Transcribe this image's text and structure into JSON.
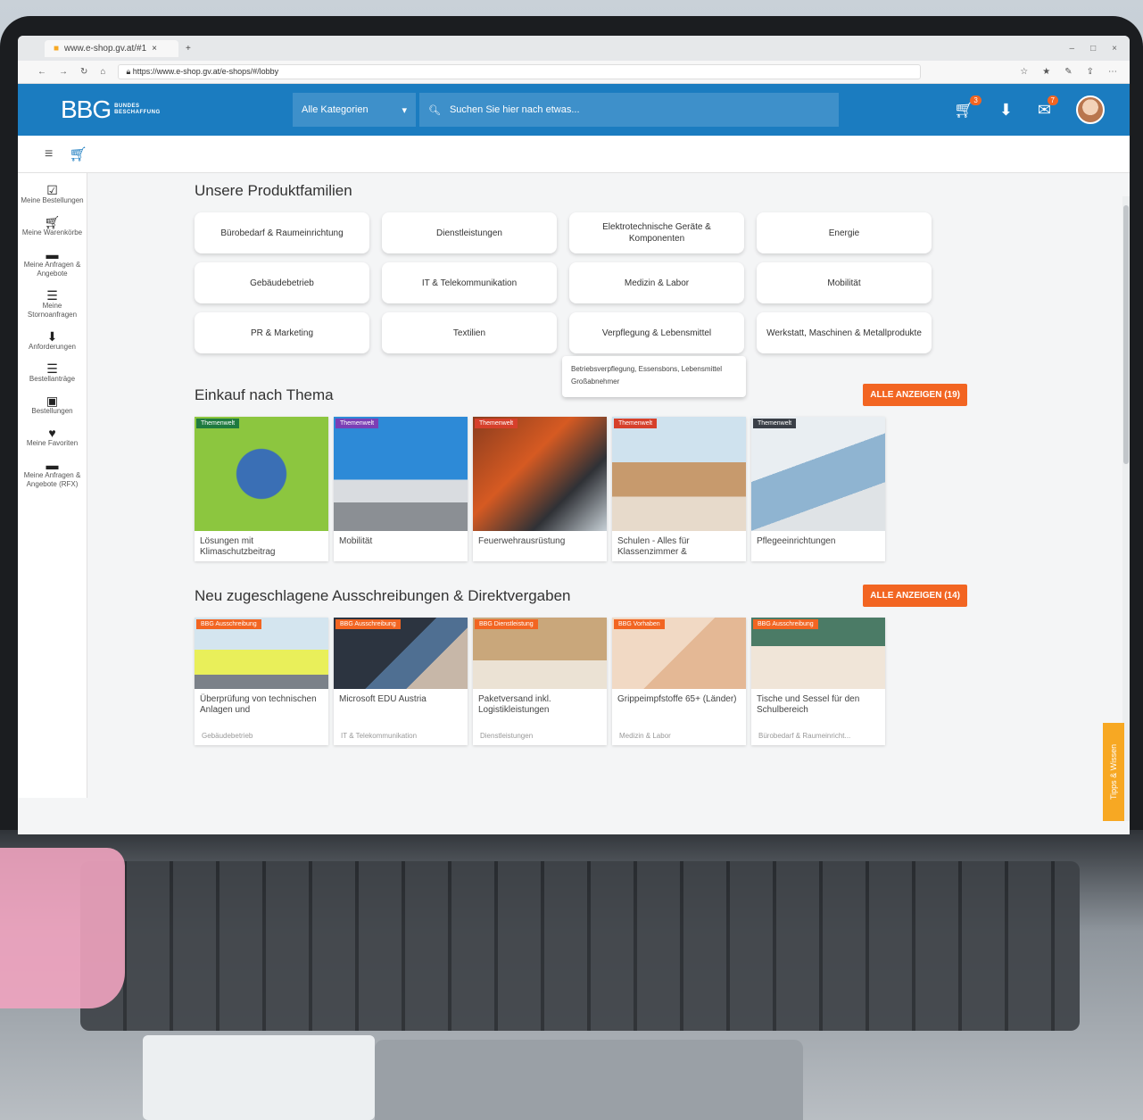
{
  "browser": {
    "tab_title": "www.e-shop.gv.at/#1",
    "url": "https://www.e-shop.gv.at/e-shops/#/lobby"
  },
  "header": {
    "logo_main": "BBG",
    "logo_sub": "BUNDES BESCHAFFUNG",
    "category_select": "Alle Kategorien",
    "search_placeholder": "Suchen Sie hier nach etwas...",
    "cart_badge": "3",
    "mail_badge": "7"
  },
  "sidebar": {
    "items": [
      {
        "label": "Meine Bestellungen",
        "icon": "clipboard-check-icon"
      },
      {
        "label": "Meine Warenkörbe",
        "icon": "cart-icon"
      },
      {
        "label": "Meine Anfragen & Angebote",
        "icon": "chat-icon"
      },
      {
        "label": "Meine Stornoanfragen",
        "icon": "cancel-list-icon"
      },
      {
        "label": "Anforderungen",
        "icon": "inbox-download-icon"
      },
      {
        "label": "Bestellanträge",
        "icon": "list-icon"
      },
      {
        "label": "Bestellungen",
        "icon": "clipboard-icon"
      },
      {
        "label": "Meine Favoriten",
        "icon": "heart-icon"
      },
      {
        "label": "Meine Anfragen & Angebote (RFX)",
        "icon": "chat-icon"
      }
    ]
  },
  "families": {
    "title": "Unsere Produktfamilien",
    "items": [
      "Bürobedarf & Raumeinrichtung",
      "Dienstleistungen",
      "Elektrotechnische Geräte & Komponenten",
      "Energie",
      "Gebäudebetrieb",
      "IT & Telekommunikation",
      "Medizin & Labor",
      "Mobilität",
      "PR & Marketing",
      "Textilien",
      "Verpflegung & Lebensmittel",
      "Werkstatt, Maschinen & Metallprodukte"
    ],
    "tooltip": "Betriebsverpflegung, Essensbons, Lebensmittel Großabnehmer"
  },
  "themes": {
    "title": "Einkauf nach Thema",
    "all_button": "ALLE ANZEIGEN (19)",
    "cards": [
      {
        "tag": "Themenwelt",
        "text": "Lösungen mit Klimaschutzbeitrag",
        "tag_color": "#1f7a3f"
      },
      {
        "tag": "Themenwelt",
        "text": "Mobilität",
        "tag_color": "#7b3fb5"
      },
      {
        "tag": "Themenwelt",
        "text": "Feuerwehrausrüstung",
        "tag_color": "#d6402b"
      },
      {
        "tag": "Themenwelt",
        "text": "Schulen - Alles für Klassenzimmer &",
        "tag_color": "#d6402b"
      },
      {
        "tag": "Themenwelt",
        "text": "Pflegeeinrichtungen",
        "tag_color": "#3a3f47"
      }
    ]
  },
  "tenders": {
    "title": "Neu zugeschlagene Ausschreibungen & Direktvergaben",
    "all_button": "ALLE ANZEIGEN (14)",
    "cards": [
      {
        "tag": "BBG Ausschreibung",
        "text": "Überprüfung von technischen Anlagen und",
        "category": "Gebäudebetrieb"
      },
      {
        "tag": "BBG Ausschreibung",
        "text": "Microsoft EDU Austria",
        "category": "IT & Telekommunikation"
      },
      {
        "tag": "BBG Dienstleistung",
        "text": "Paketversand inkl. Logistikleistungen",
        "category": "Dienstleistungen"
      },
      {
        "tag": "BBG Vorhaben",
        "text": "Grippeimpfstoffe 65+ (Länder)",
        "category": "Medizin & Labor"
      },
      {
        "tag": "BBG Ausschreibung",
        "text": "Tische und Sessel für den Schulbereich",
        "category": "Bürobedarf & Raumeinricht..."
      }
    ]
  },
  "tips_tab": "Tipps & Wissen",
  "colors": {
    "brand_blue": "#1b7cc0",
    "accent_orange": "#f26522",
    "tips_orange": "#f7a823"
  }
}
